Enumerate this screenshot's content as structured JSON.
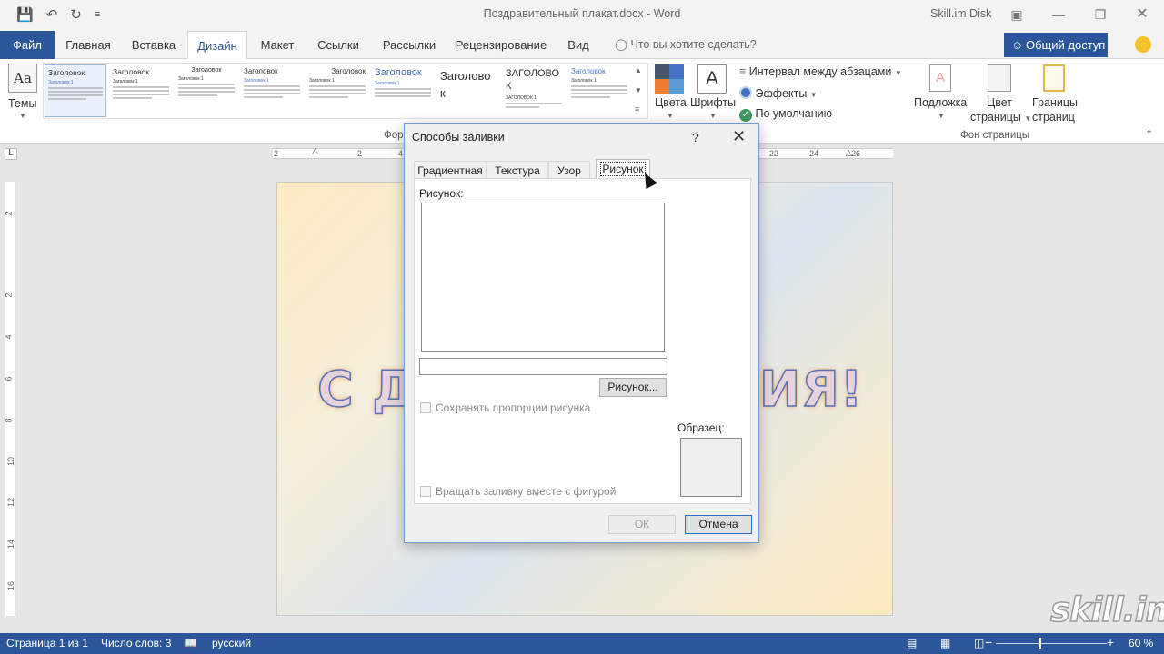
{
  "window": {
    "title": "Поздравительный плакат.docx - Word",
    "account": "Skill.im Disk"
  },
  "tabs": {
    "file": "Файл",
    "items": [
      "Главная",
      "Вставка",
      "Дизайн",
      "Макет",
      "Ссылки",
      "Рассылки",
      "Рецензирование",
      "Вид"
    ],
    "active": "Дизайн",
    "tell_me": "Что вы хотите сделать?",
    "share": "Общий доступ"
  },
  "ribbon": {
    "themes_label": "Темы",
    "theme_icon_text": "Aa",
    "styles": [
      {
        "heading": "Заголовок",
        "sub": "Заголовок 1"
      },
      {
        "heading": "Заголовок",
        "sub": "Заголовок 1"
      },
      {
        "heading": "Заголовок",
        "sub": "Заголовок 1"
      },
      {
        "heading": "Заголовок",
        "sub": "Заголовок 1"
      },
      {
        "heading": "Заголовок",
        "sub": "Заголовок 1"
      },
      {
        "heading": "Заголовок",
        "sub": "Заголовок 1"
      },
      {
        "heading": "Заголово к",
        "sub": ""
      },
      {
        "heading": "ЗАГОЛОВО К",
        "sub": "ЗАГОЛОВОК 1"
      },
      {
        "heading": "Заголовок",
        "sub": "Заголовок 1"
      }
    ],
    "format_group_label": "Фор",
    "colors_label": "Цвета",
    "fonts_label": "Шрифты",
    "fonts_icon_text": "A",
    "paragraph_spacing": "Интервал между абзацами",
    "effects": "Эффекты",
    "default": "По умолчанию",
    "watermark": "Подложка",
    "page_color_line1": "Цвет",
    "page_color_line2": "страницы",
    "page_borders_line1": "Границы",
    "page_borders_line2": "страниц",
    "page_background_group": "Фон страницы"
  },
  "ruler": {
    "horizontal": [
      "2",
      "2",
      "4",
      "22",
      "24",
      "26"
    ],
    "vertical": [
      "2",
      "2",
      "4",
      "6",
      "8",
      "10",
      "12",
      "14",
      "16"
    ],
    "corner": "L"
  },
  "document": {
    "poster_left": "С Д",
    "poster_right": "ИЯ!"
  },
  "dialog": {
    "title": "Способы заливки",
    "help": "?",
    "tabs": [
      "Градиентная",
      "Текстура",
      "Узор",
      "Рисунок"
    ],
    "selected_tab": "Рисунок",
    "picture_label": "Рисунок:",
    "picture_button": "Рисунок...",
    "lock_ratio": "Сохранять пропорции рисунка",
    "rotate_with_shape": "Вращать заливку вместе с фигурой",
    "sample_label": "Образец:",
    "ok": "ОК",
    "cancel": "Отмена"
  },
  "statusbar": {
    "page": "Страница 1 из 1",
    "words": "Число слов: 3",
    "language": "русский",
    "zoom": "60 %"
  },
  "watermark_logo": "skill.im",
  "colors": {
    "brand": "#2b579a",
    "ribbon_bg": "#ffffff",
    "title_bg": "#f3f3f3"
  }
}
